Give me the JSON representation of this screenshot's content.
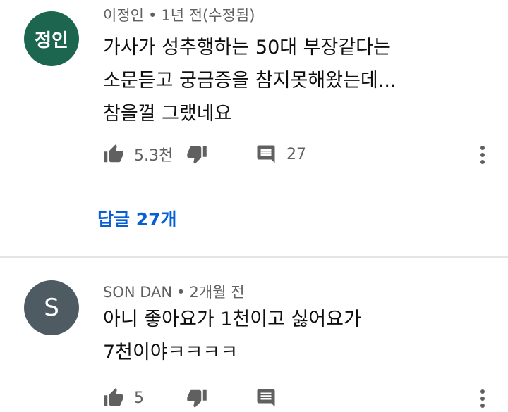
{
  "comments": [
    {
      "avatar_text": "정인",
      "author": "이정인",
      "dot": "•",
      "time": "1년 전(수정됨)",
      "lines": [
        "가사가 성추행하는 50대 부장같다는",
        "소문듣고 궁금증을 참지못해왔는데...",
        "참을껄 그랬네요"
      ],
      "likes": "5.3천",
      "reply_count": "27",
      "replies_link": "답글 27개"
    },
    {
      "avatar_text": "S",
      "author": "SON DAN",
      "dot": "•",
      "time": "2개월 전",
      "lines": [
        "아니 좋아요가 1천이고 싫어요가",
        "7천이야ㅋㅋㅋㅋ"
      ],
      "likes": "5"
    }
  ],
  "icons": [
    "thumb-up-icon",
    "thumb-down-icon",
    "reply-icon",
    "more-vert-icon"
  ],
  "colors": {
    "avatar_1": "#1c6650",
    "avatar_2": "#4f5b62",
    "link": "#065fd4",
    "meta": "#606060",
    "icon": "#606060"
  }
}
